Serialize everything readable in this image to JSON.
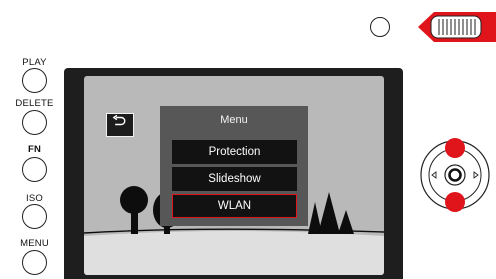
{
  "side_buttons": {
    "play": "PLAY",
    "delete": "DELETE",
    "fn": "FN",
    "iso": "ISO",
    "menu": "MENU"
  },
  "screen_menu": {
    "title": "Menu",
    "items": [
      {
        "label": "Protection",
        "selected": false
      },
      {
        "label": "Slideshow",
        "selected": false
      },
      {
        "label": "WLAN",
        "selected": true
      }
    ]
  },
  "colors": {
    "accent_red": "#e0151b",
    "lcd_background": "#b9b9b9",
    "menu_panel": "#575757",
    "menu_item": "#121212"
  },
  "icons": {
    "back": "return-arrow-icon",
    "nav_center": "center-button-icon",
    "nav_left": "arrow-left-icon",
    "nav_right": "arrow-right-icon",
    "dial": "thumbwheel-icon"
  }
}
